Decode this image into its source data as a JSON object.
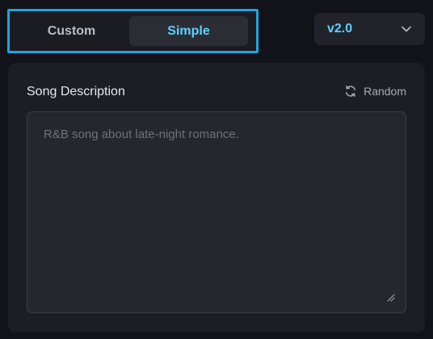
{
  "mode_toggle": {
    "options": [
      "Custom",
      "Simple"
    ],
    "selected": "Simple"
  },
  "version_select": {
    "value": "v2.0"
  },
  "song_panel": {
    "title": "Song Description",
    "random_label": "Random",
    "description_placeholder": "R&B song about late-night romance.",
    "description_value": ""
  },
  "colors": {
    "accent": "#5ad3ff",
    "highlight_border": "#1fa3e0",
    "background": "#121318",
    "panel": "#1d1e25"
  },
  "icons": {
    "random": "refresh-icon",
    "version": "chevron-down-icon",
    "textarea": "resize-handle-icon"
  }
}
